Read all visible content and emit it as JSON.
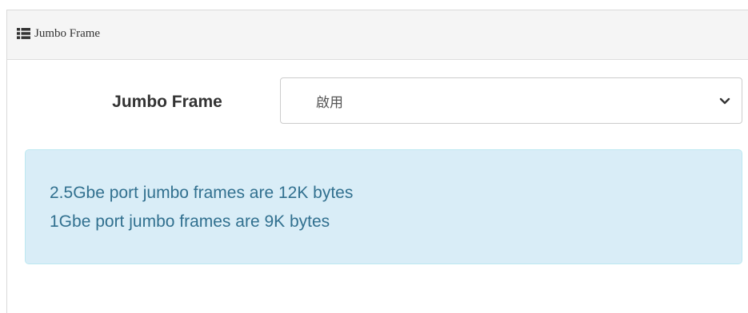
{
  "panel": {
    "title": "Jumbo Frame",
    "title_icon": "list-icon"
  },
  "form": {
    "label": "Jumbo Frame",
    "select_value": "啟用",
    "select_icon": "chevron-down-icon"
  },
  "info": {
    "lines": [
      "2.5Gbe port jumbo frames are 12K bytes",
      "1Gbe port jumbo frames are 9K bytes"
    ]
  },
  "colors": {
    "heading_bg": "#f5f5f5",
    "info_bg": "#d9edf7",
    "info_border": "#bce8f1",
    "info_text": "#31708f"
  }
}
